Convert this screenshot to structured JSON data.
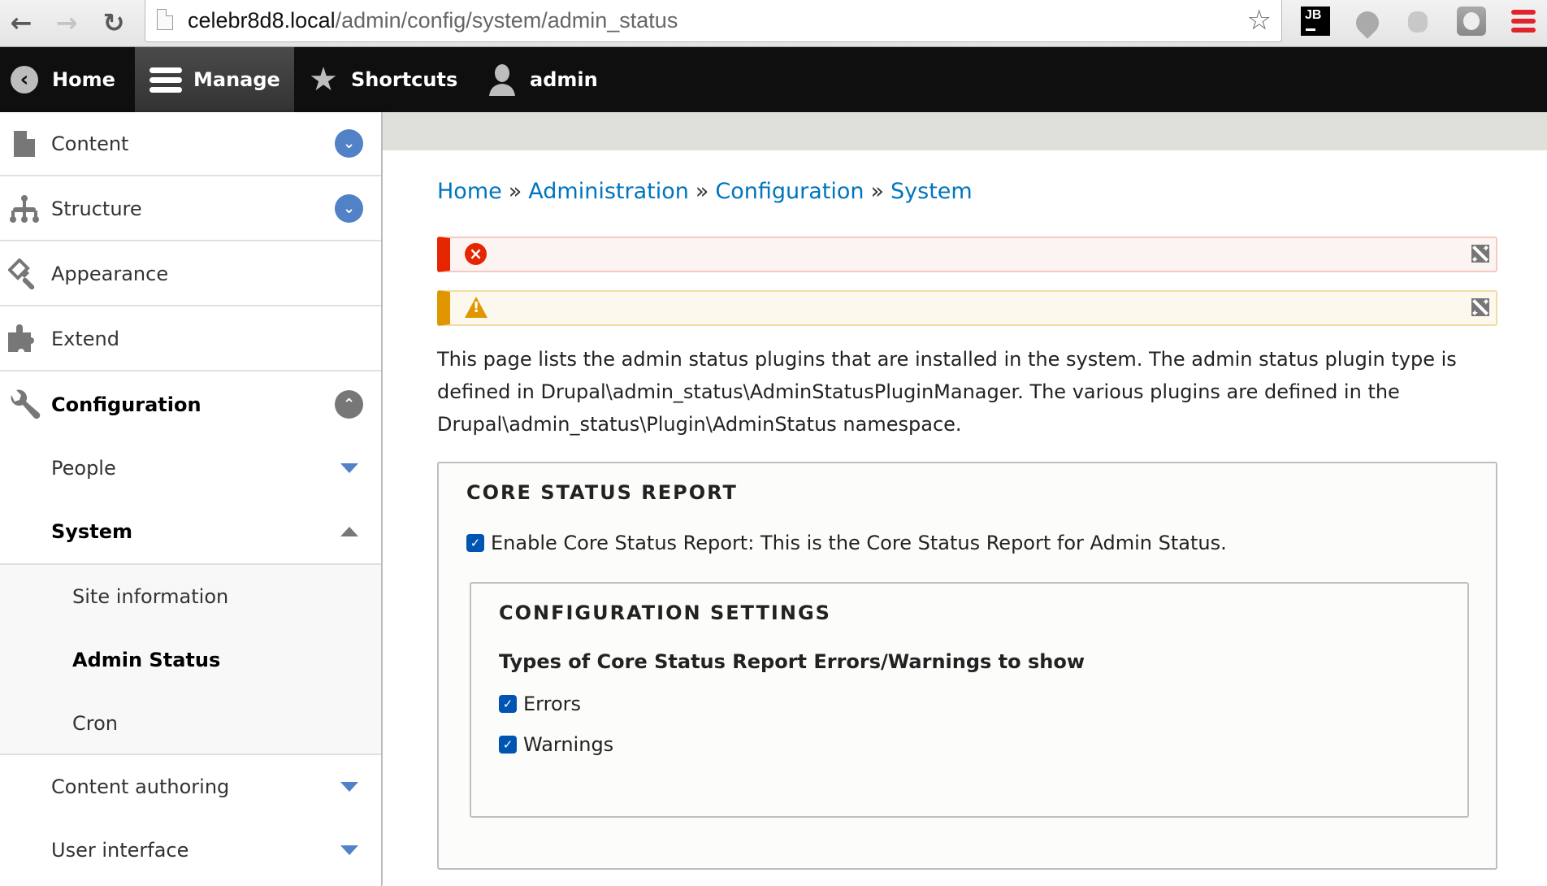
{
  "browser": {
    "url_host": "celebr8d8.local",
    "url_path": "/admin/config/system/admin_status",
    "back_icon": "←",
    "forward_icon": "→",
    "reload_icon": "↻",
    "bookmark_icon": "☆",
    "extensions": [
      {
        "name": "jetbrains-extension-icon",
        "label": "JB"
      },
      {
        "name": "drupal-extension-icon"
      },
      {
        "name": "bug-extension-icon"
      },
      {
        "name": "ghost-extension-icon"
      },
      {
        "name": "chrome-menu-icon"
      }
    ]
  },
  "toolbar": {
    "home": "Home",
    "manage": "Manage",
    "shortcuts": "Shortcuts",
    "user": "admin"
  },
  "sidebar": {
    "items": [
      {
        "label": "Content",
        "icon": "file-icon",
        "expanded": false
      },
      {
        "label": "Structure",
        "icon": "sitemap-icon",
        "expanded": false
      },
      {
        "label": "Appearance",
        "icon": "paintbrush-icon"
      },
      {
        "label": "Extend",
        "icon": "puzzle-icon"
      },
      {
        "label": "Configuration",
        "icon": "wrench-icon",
        "expanded": true,
        "active": true
      }
    ],
    "config_children": [
      {
        "label": "People",
        "expanded": false
      },
      {
        "label": "System",
        "expanded": true,
        "active": true
      },
      {
        "label": "Content authoring",
        "expanded": false
      },
      {
        "label": "User interface",
        "expanded": false
      }
    ],
    "system_children": [
      {
        "label": "Site information"
      },
      {
        "label": "Admin Status",
        "active": true
      },
      {
        "label": "Cron"
      }
    ]
  },
  "main": {
    "breadcrumb": [
      "Home",
      "Administration",
      "Configuration",
      "System"
    ],
    "breadcrumb_separator": "»",
    "messages": [
      {
        "type": "error",
        "icon": "×",
        "text": ""
      },
      {
        "type": "warning",
        "icon": "!",
        "text": ""
      }
    ],
    "description": "This page lists the admin status plugins that are installed in the system. The admin status plugin type is defined in Drupal\\admin_status\\AdminStatusPluginManager. The various plugins are defined in the Drupal\\admin_status\\Plugin\\AdminStatus namespace.",
    "core_status": {
      "legend": "Core Status Report",
      "enable_label": "Enable Core Status Report: This is the Core Status Report for Admin Status.",
      "enable_checked": true,
      "config": {
        "legend": "Configuration Settings",
        "field_label": "Types of Core Status Report Errors/Warnings to show",
        "options": [
          {
            "label": "Errors",
            "checked": true
          },
          {
            "label": "Warnings",
            "checked": true
          }
        ]
      }
    }
  },
  "colors": {
    "link": "#0074bd",
    "toggle_blue": "#5181c6",
    "error": "#e62600",
    "warning": "#e09600",
    "checkbox": "#0055b3"
  }
}
